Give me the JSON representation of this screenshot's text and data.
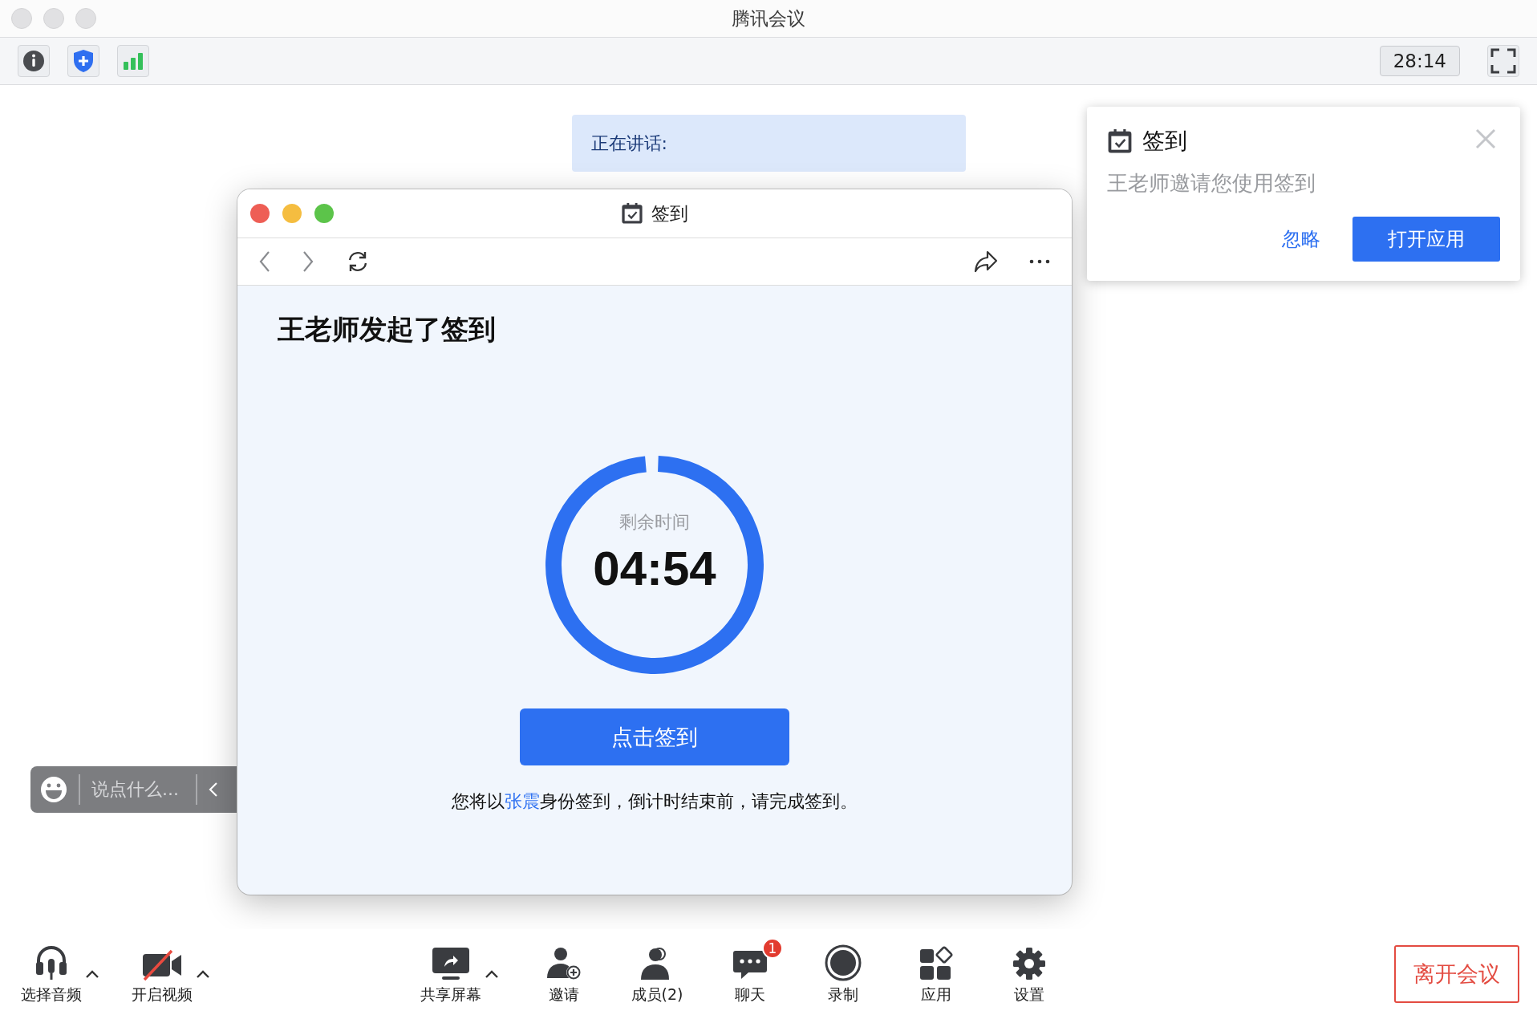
{
  "window": {
    "title": "腾讯会议"
  },
  "toolbar": {
    "timer": "28:14"
  },
  "speaking": {
    "label": "正在讲话:"
  },
  "chat_input": {
    "placeholder": "说点什么..."
  },
  "signin_window": {
    "title": "签到",
    "heading": "王老师发起了签到",
    "countdown_label": "剩余时间",
    "countdown": "04:54",
    "level": 0.98,
    "button": "点击签到",
    "note_before": "您将以",
    "note_name": "张震",
    "note_after": "身份签到，倒计时结束前，请完成签到。"
  },
  "notification": {
    "title": "签到",
    "message": "王老师邀请您使用签到",
    "ignore_button": "忽略",
    "open_button": "打开应用"
  },
  "bottom_bar": {
    "left": [
      {
        "label": "选择音频",
        "has_menu": true
      },
      {
        "label": "开启视频",
        "has_menu": true
      }
    ],
    "center": [
      {
        "label": "共享屏幕",
        "has_menu": true
      },
      {
        "label": "邀请",
        "has_menu": false
      },
      {
        "label": "成员(2)",
        "has_menu": false
      },
      {
        "label": "聊天",
        "has_menu": false,
        "badge": "1"
      },
      {
        "label": "录制",
        "has_menu": false
      },
      {
        "label": "应用",
        "has_menu": false
      },
      {
        "label": "设置",
        "has_menu": false
      }
    ],
    "leave_button": "离开会议"
  }
}
